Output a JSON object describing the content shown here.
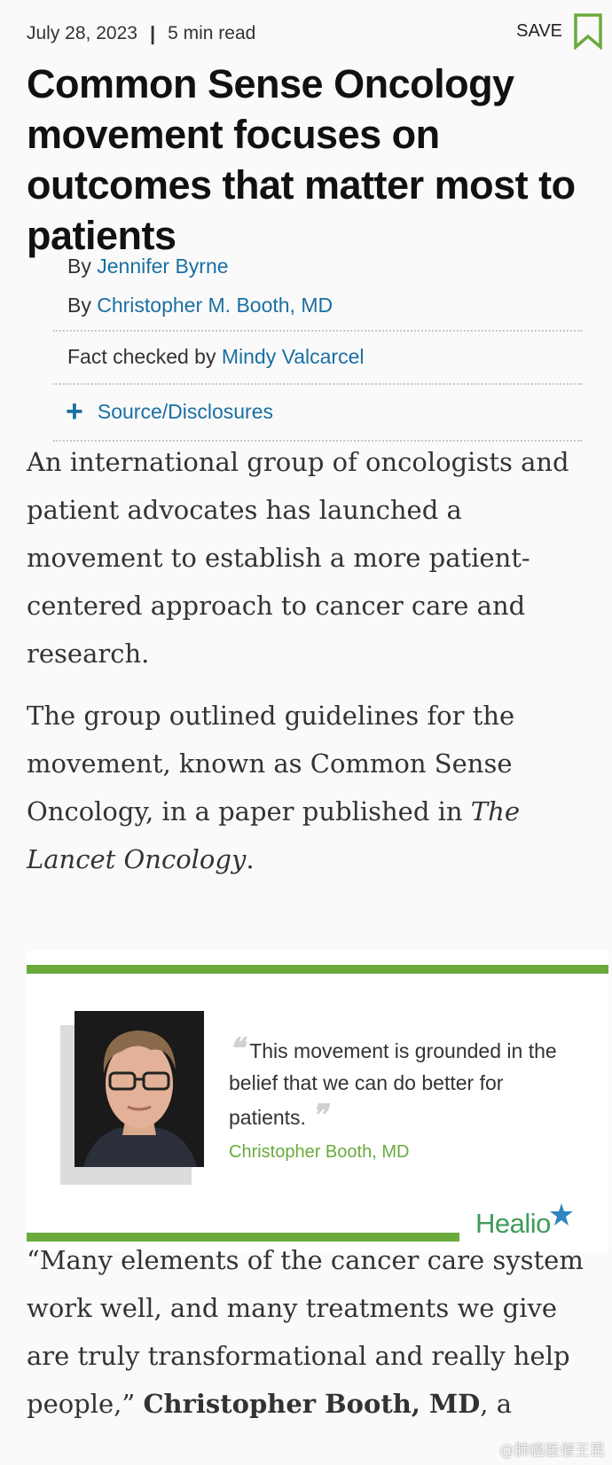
{
  "meta": {
    "date": "July 28, 2023",
    "separator": "|",
    "read_time": "5 min read"
  },
  "save_label": "SAVE",
  "headline": "Common Sense Oncology movement focuses on outcomes that matter most to patients",
  "byline": {
    "prefix": "By",
    "authors": [
      "Jennifer Byrne",
      "Christopher M. Booth, MD"
    ],
    "fact_check_prefix": "Fact checked by",
    "fact_checker": "Mindy Valcarcel",
    "source_label": "Source/Disclosures"
  },
  "paragraphs": {
    "p1": "An international group of oncologists and patient advocates has launched a movement to establish a more patient-centered approach to cancer care and research.",
    "p2_text": "The group outlined guidelines for the movement, known as Common Sense Oncology, in a paper published in ",
    "p2_journal": "The Lancet Oncology",
    "p2_end": ".",
    "p3_text": "“Many elements of the cancer care system work well, and many treatments we give are truly transformational and really help people,” ",
    "p3_bold": "Christopher Booth, MD",
    "p3_end": ", a"
  },
  "figure": {
    "quote": "This movement is grounded in the belief that we can do better for patients.",
    "attribution": "Christopher Booth, MD",
    "logo_text": "Healio",
    "accent_color": "#6aab3c"
  },
  "watermark": "@肺癌医僧王昆"
}
